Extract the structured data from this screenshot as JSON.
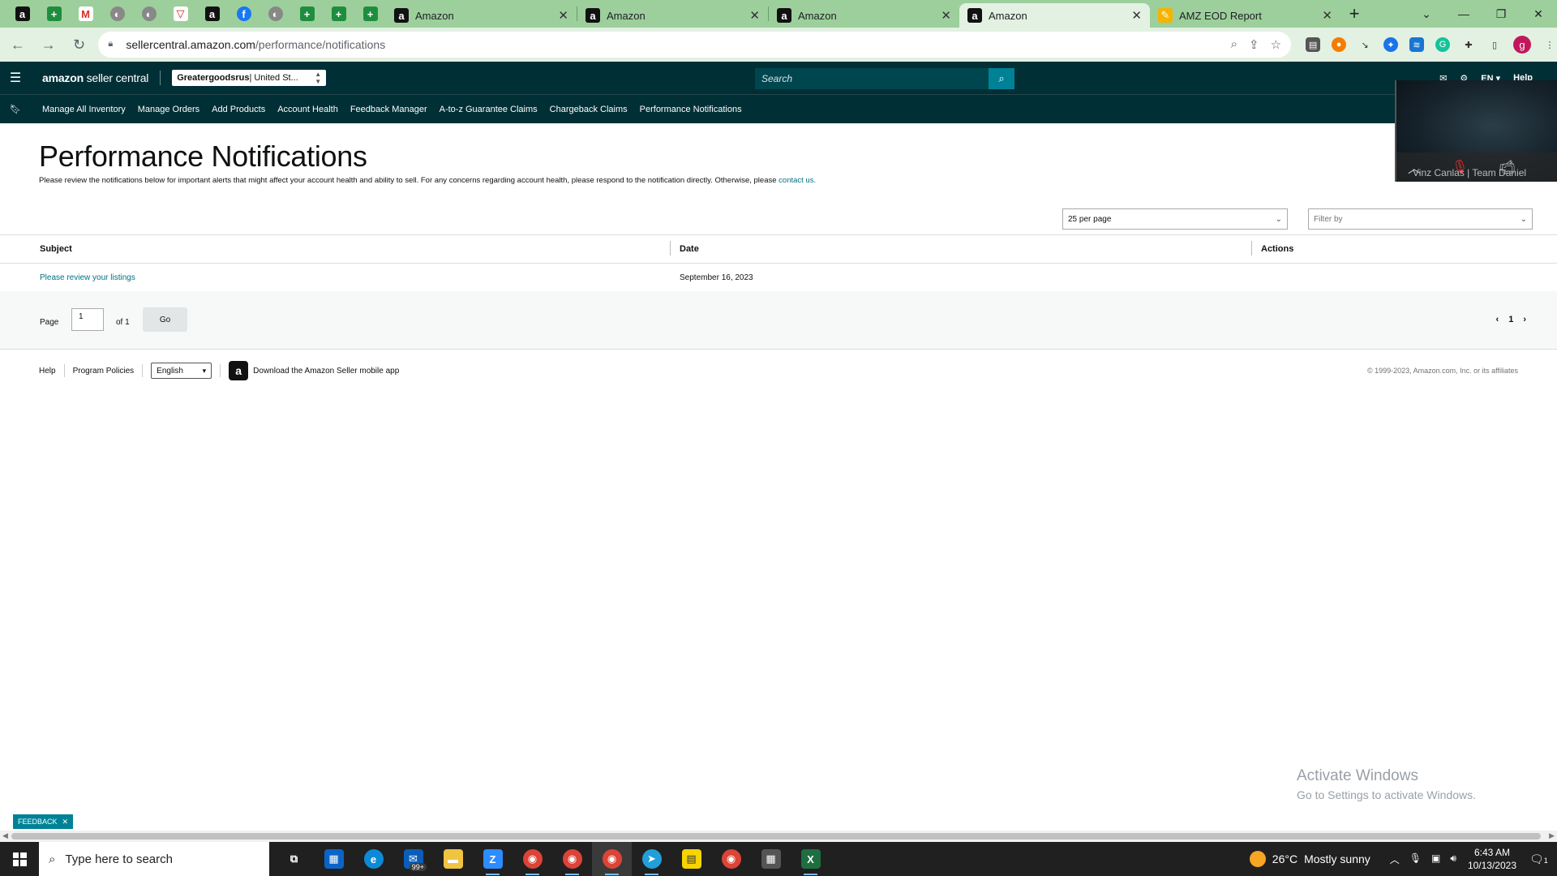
{
  "browser": {
    "pinned_tabs": [
      {
        "icon": "amazon-icon",
        "glyph": "a"
      },
      {
        "icon": "sheets-icon",
        "glyph": "+"
      },
      {
        "icon": "gmail-icon",
        "glyph": "M"
      },
      {
        "icon": "globe-icon",
        "glyph": "◐"
      },
      {
        "icon": "globe-icon",
        "glyph": "◐"
      },
      {
        "icon": "shield-icon",
        "glyph": "▽"
      },
      {
        "icon": "amazon-icon",
        "glyph": "a"
      },
      {
        "icon": "facebook-icon",
        "glyph": "f"
      },
      {
        "icon": "globe-icon",
        "glyph": "◐"
      },
      {
        "icon": "sheets-icon",
        "glyph": "+"
      },
      {
        "icon": "sheets-icon",
        "glyph": "+"
      },
      {
        "icon": "sheets-icon",
        "glyph": "+"
      }
    ],
    "tabs": [
      {
        "title": "Amazon",
        "active": false
      },
      {
        "title": "Amazon",
        "active": false
      },
      {
        "title": "Amazon",
        "active": false
      },
      {
        "title": "Amazon",
        "active": true
      },
      {
        "title": "AMZ EOD Report",
        "active": false
      }
    ],
    "url_host": "sellercentral.amazon.com",
    "url_path": "/performance/notifications",
    "profile_initial": "g"
  },
  "header": {
    "logo_bold": "amazon",
    "logo_light": " seller central",
    "store_name": "Greatergoodsrus",
    "store_region": " | United St...",
    "search_placeholder": "Search",
    "lang": "EN",
    "help": "Help"
  },
  "nav": {
    "items": [
      "Manage All Inventory",
      "Manage Orders",
      "Add Products",
      "Account Health",
      "Feedback Manager",
      "A-to-z Guarantee Claims",
      "Chargeback Claims",
      "Performance Notifications"
    ]
  },
  "video_overlay": {
    "names": "Vinz Canlas | Team Daniel"
  },
  "page": {
    "title": "Performance Notifications",
    "description": "Please review the notifications below for important alerts that might affect your account health and ability to sell. For any concerns regarding account health, please respond to the notification directly. Otherwise, please ",
    "contact_link": "contact us.",
    "per_page": "25 per page",
    "filter_placeholder": "Filter by"
  },
  "table": {
    "headers": [
      "Subject",
      "Date",
      "Actions"
    ],
    "rows": [
      {
        "subject": "Please review your listings",
        "date": "September 16, 2023",
        "actions": ""
      }
    ]
  },
  "pager": {
    "label": "Page",
    "current": "1",
    "of": "of 1",
    "go": "Go",
    "page_number": "1"
  },
  "footer": {
    "help": "Help",
    "policies": "Program Policies",
    "language": "English",
    "app": "Download the Amazon Seller mobile app",
    "copyright": "© 1999-2023, Amazon.com, Inc. or its affiliates"
  },
  "activate": {
    "line1": "Activate Windows",
    "line2": "Go to Settings to activate Windows."
  },
  "feedback_label": "FEEDBACK",
  "taskbar": {
    "search_placeholder": "Type here to search",
    "mail_badge": "99+",
    "temperature": "26°C",
    "weather": "Mostly sunny",
    "time": "6:43 AM",
    "date": "10/13/2023",
    "notification_count": "1"
  },
  "colors": {
    "header_bg": "#002f36",
    "link": "#007185",
    "search_button": "#008296",
    "tab_strip": "#9ccf9c"
  }
}
